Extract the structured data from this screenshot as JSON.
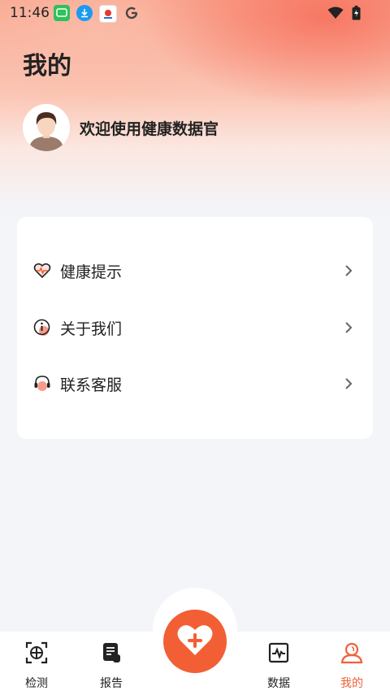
{
  "status_bar": {
    "time": "11:46",
    "notification_icons": [
      "chat-app-icon",
      "download-icon",
      "news-app-icon",
      "google-icon"
    ],
    "right_icons": [
      "wifi-icon",
      "battery-charging-icon"
    ]
  },
  "page": {
    "title": "我的",
    "welcome_text": "欢迎使用健康数据官"
  },
  "menu": {
    "items": [
      {
        "label": "健康提示",
        "icon": "heart-pulse-icon"
      },
      {
        "label": "关于我们",
        "icon": "info-icon"
      },
      {
        "label": "联系客服",
        "icon": "headset-icon"
      }
    ]
  },
  "tabbar": {
    "tabs": [
      {
        "label": "检测",
        "icon": "scan-target-icon",
        "active": false
      },
      {
        "label": "报告",
        "icon": "report-scroll-icon",
        "active": false
      },
      {
        "label": "数据",
        "icon": "data-chart-icon",
        "active": false
      },
      {
        "label": "我的",
        "icon": "user-icon",
        "active": true
      }
    ],
    "center_button": {
      "icon": "heart-plus-icon"
    }
  },
  "colors": {
    "accent": "#f25f35",
    "active_tab": "#f0613a",
    "background": "#f4f5f9",
    "header_gradient": "#f9a892"
  }
}
